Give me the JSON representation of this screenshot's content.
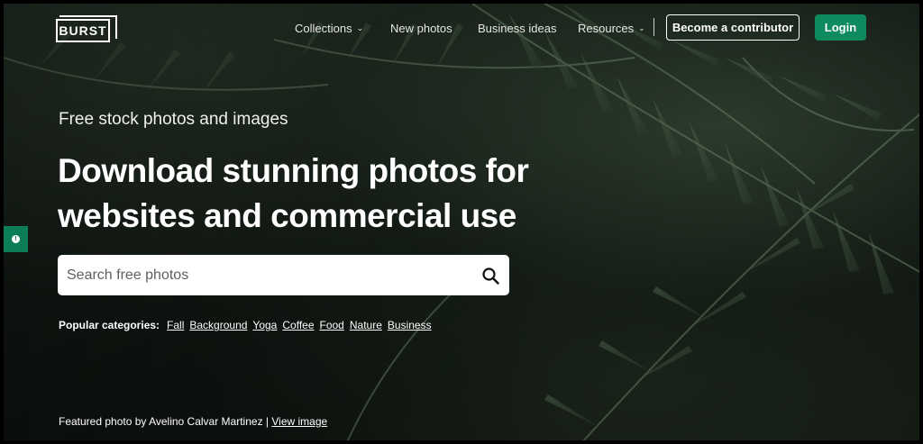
{
  "header": {
    "logo_text": "BURST",
    "nav": [
      {
        "label": "Collections",
        "has_dropdown": true
      },
      {
        "label": "New photos",
        "has_dropdown": false
      },
      {
        "label": "Business ideas",
        "has_dropdown": false
      },
      {
        "label": "Resources",
        "has_dropdown": true
      }
    ],
    "contributor_label": "Become a contributor",
    "login_label": "Login"
  },
  "hero": {
    "eyebrow": "Free stock photos and images",
    "headline_line1": "Download stunning photos for",
    "headline_line2": "websites and commercial use"
  },
  "search": {
    "placeholder": "Search free photos",
    "icon": "search-icon"
  },
  "categories": {
    "label": "Popular categories:",
    "items": [
      "Fall",
      "Background",
      "Yoga",
      "Coffee",
      "Food",
      "Nature",
      "Business"
    ]
  },
  "credit": {
    "text": "Featured photo by Avelino Calvar Martinez |",
    "link": "View image"
  },
  "colors": {
    "accent_green": "#0e8a5f",
    "background": "#141b15"
  }
}
